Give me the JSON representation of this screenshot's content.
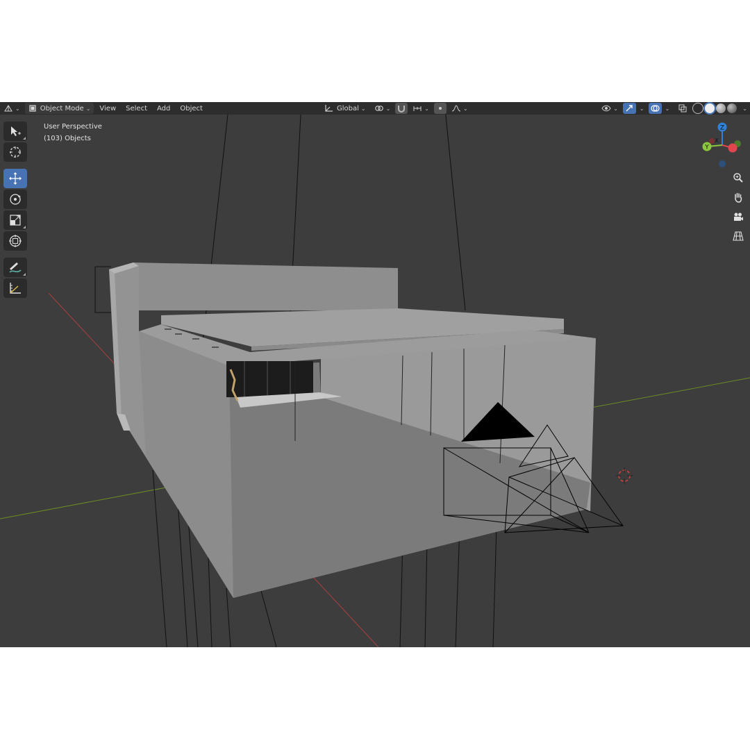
{
  "header": {
    "editor_type_icon": "grid-axes-icon",
    "mode": "Object Mode",
    "menus": [
      "View",
      "Select",
      "Add",
      "Object"
    ],
    "orientation": "Global",
    "icons": [
      "transform-pivot-icon",
      "link-icon",
      "snap-magnet-icon",
      "snap-increment-icon",
      "proportional-edit-icon",
      "falloff-curve-icon",
      "visibility-eye-icon",
      "gizmo-arrow-icon",
      "overlay-icon",
      "xray-icon",
      "solid-shading-icon",
      "material-shading-icon",
      "rendered-shading-icon"
    ],
    "accent": "#4772b3"
  },
  "viewport": {
    "view_name": "User Perspective",
    "object_count": "(103) Objects",
    "background": "#3d3d3d",
    "axis_colors": {
      "x": "#ab3f3f",
      "y": "#6b8e23"
    }
  },
  "toolbar": {
    "tools": [
      {
        "name": "select-box-icon",
        "active": false
      },
      {
        "name": "cursor-icon",
        "active": false
      },
      {
        "name": "move-icon",
        "active": true
      },
      {
        "name": "rotate-icon",
        "active": false
      },
      {
        "name": "scale-icon",
        "active": false
      },
      {
        "name": "transform-icon",
        "active": false
      },
      {
        "name": "annotate-icon",
        "active": false
      },
      {
        "name": "measure-icon",
        "active": false
      }
    ]
  },
  "navigation": {
    "gizmo_axes": [
      {
        "label": "Z",
        "color": "#2f82d6"
      },
      {
        "label": "Y",
        "color": "#8cc63f"
      },
      {
        "label": "X",
        "color": "#e0464e"
      }
    ],
    "buttons": [
      "zoom-icon",
      "hand-pan-icon",
      "camera-icon",
      "grid-ortho-icon"
    ]
  }
}
